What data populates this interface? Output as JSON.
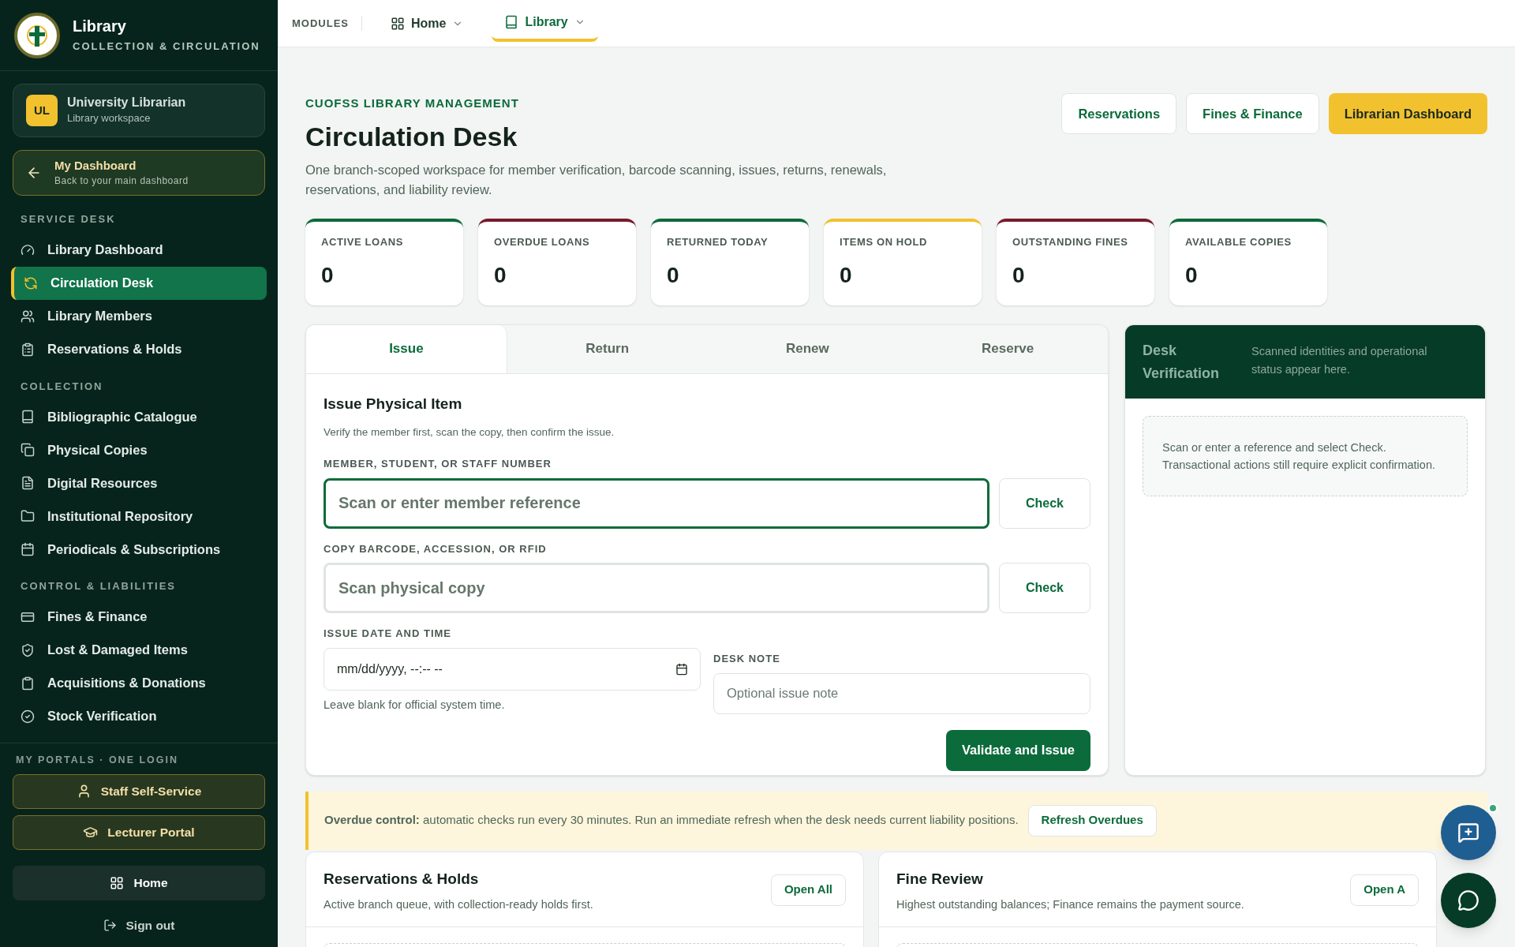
{
  "brand": {
    "title": "Library",
    "subtitle": "COLLECTION & CIRCULATION"
  },
  "user": {
    "initials": "UL",
    "name": "University Librarian",
    "role": "Library workspace"
  },
  "back_link": {
    "title": "My Dashboard",
    "subtitle": "Back to your main dashboard"
  },
  "sidebar": {
    "sections": [
      {
        "heading": "SERVICE DESK",
        "items": [
          {
            "label": "Library Dashboard",
            "selected": false
          },
          {
            "label": "Circulation Desk",
            "selected": true
          },
          {
            "label": "Library Members",
            "selected": false
          },
          {
            "label": "Reservations & Holds",
            "selected": false
          }
        ]
      },
      {
        "heading": "COLLECTION",
        "items": [
          {
            "label": "Bibliographic Catalogue",
            "selected": false
          },
          {
            "label": "Physical Copies",
            "selected": false
          },
          {
            "label": "Digital Resources",
            "selected": false
          },
          {
            "label": "Institutional Repository",
            "selected": false
          },
          {
            "label": "Periodicals & Subscriptions",
            "selected": false
          }
        ]
      },
      {
        "heading": "CONTROL & LIABILITIES",
        "items": [
          {
            "label": "Fines & Finance",
            "selected": false
          },
          {
            "label": "Lost & Damaged Items",
            "selected": false
          },
          {
            "label": "Acquisitions & Donations",
            "selected": false
          },
          {
            "label": "Stock Verification",
            "selected": false
          }
        ]
      }
    ],
    "portals_heading": "MY PORTALS · ONE LOGIN",
    "portals": [
      "Staff Self-Service",
      "Lecturer Portal"
    ],
    "home": "Home",
    "sign_out": "Sign out"
  },
  "topbar": {
    "label": "MODULES",
    "modules": [
      {
        "label": "Home",
        "selected": false
      },
      {
        "label": "Library",
        "selected": true
      }
    ]
  },
  "header": {
    "eyebrow": "CUOFSS LIBRARY MANAGEMENT",
    "title": "Circulation Desk",
    "description": "One branch-scoped workspace for member verification, barcode scanning, issues, returns, renewals, reservations, and liability review.",
    "actions": [
      {
        "label": "Reservations",
        "primary": false
      },
      {
        "label": "Fines & Finance",
        "primary": false
      },
      {
        "label": "Librarian Dashboard",
        "primary": true
      }
    ]
  },
  "stats": [
    {
      "label": "ACTIVE LOANS",
      "value": "0",
      "color": "#0b6b3a"
    },
    {
      "label": "OVERDUE LOANS",
      "value": "0",
      "color": "#7a1a2a"
    },
    {
      "label": "RETURNED TODAY",
      "value": "0",
      "color": "#0b6b3a"
    },
    {
      "label": "ITEMS ON HOLD",
      "value": "0",
      "color": "#f2c12e"
    },
    {
      "label": "OUTSTANDING FINES",
      "value": "0",
      "color": "#7a1a2a"
    },
    {
      "label": "AVAILABLE COPIES",
      "value": "0",
      "color": "#0b6b3a"
    }
  ],
  "tabs": [
    {
      "label": "Issue",
      "selected": true
    },
    {
      "label": "Return",
      "selected": false
    },
    {
      "label": "Renew",
      "selected": false
    },
    {
      "label": "Reserve",
      "selected": false
    }
  ],
  "form": {
    "title": "Issue Physical Item",
    "description": "Verify the member first, scan the copy, then confirm the issue.",
    "member": {
      "label": "MEMBER, STUDENT, OR STAFF NUMBER",
      "placeholder": "Scan or enter member reference",
      "focused": true,
      "button": "Check"
    },
    "copy": {
      "label": "COPY BARCODE, ACCESSION, OR RFID",
      "placeholder": "Scan physical copy",
      "focused": false,
      "button": "Check"
    },
    "date": {
      "label": "ISSUE DATE AND TIME",
      "placeholder": "mm/dd/yyyy, --:-- --",
      "hint": "Leave blank for official system time."
    },
    "note": {
      "label": "DESK NOTE",
      "placeholder": "Optional issue note"
    },
    "submit": "Validate and Issue"
  },
  "verification": {
    "title": "Desk Verification",
    "subtitle": "Scanned identities and operational status appear here.",
    "empty": "Scan or enter a reference and select Check. Transactional actions still require explicit confirmation."
  },
  "notice": {
    "text": "**Overdue control:** automatic checks run every 30 minutes. Run an immediate refresh when the desk needs current liability positions.",
    "button": "Refresh Overdues"
  },
  "panels": [
    {
      "title": "Reservations & Holds",
      "description": "Active branch queue, with collection-ready holds first.",
      "button": "Open All"
    },
    {
      "title": "Fine Review",
      "description": "Highest outstanding balances; Finance remains the payment source.",
      "button": "Open A"
    }
  ],
  "assistant": {
    "online": true
  }
}
